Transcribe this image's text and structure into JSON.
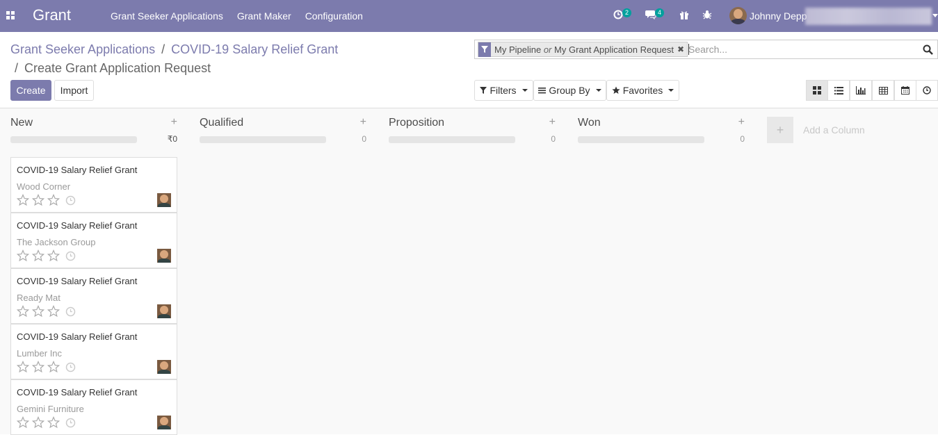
{
  "navbar": {
    "brand": "Grant",
    "menu": [
      "Grant Seeker Applications",
      "Grant Maker",
      "Configuration"
    ],
    "activity_count": "2",
    "messages_count": "4",
    "user_name": "Johnny Depp",
    "color": "#7c7bad"
  },
  "breadcrumb": {
    "items": [
      "Grant Seeker Applications",
      "COVID-19 Salary Relief Grant"
    ],
    "active": "Create Grant Application Request",
    "separator": "/"
  },
  "search": {
    "facet_part1": "My Pipeline",
    "facet_or": "or",
    "facet_part2": "My Grant Application Request",
    "placeholder": "Search..."
  },
  "buttons": {
    "create": "Create",
    "import": "Import",
    "filters": "Filters",
    "group_by": "Group By",
    "favorites": "Favorites"
  },
  "view_switcher": [
    "kanban-icon",
    "list-icon",
    "graph-icon",
    "pivot-icon",
    "calendar-icon",
    "activity-icon"
  ],
  "columns": [
    {
      "title": "New",
      "sum": "₹0"
    },
    {
      "title": "Qualified",
      "sum": "0"
    },
    {
      "title": "Proposition",
      "sum": "0"
    },
    {
      "title": "Won",
      "sum": "0"
    }
  ],
  "add_column_label": "Add a Column",
  "cards": [
    {
      "title": "COVID-19 Salary Relief Grant",
      "partner": "Wood Corner"
    },
    {
      "title": "COVID-19 Salary Relief Grant",
      "partner": "The Jackson Group"
    },
    {
      "title": "COVID-19 Salary Relief Grant",
      "partner": "Ready Mat"
    },
    {
      "title": "COVID-19 Salary Relief Grant",
      "partner": "Lumber Inc"
    },
    {
      "title": "COVID-19 Salary Relief Grant",
      "partner": "Gemini Furniture"
    }
  ]
}
